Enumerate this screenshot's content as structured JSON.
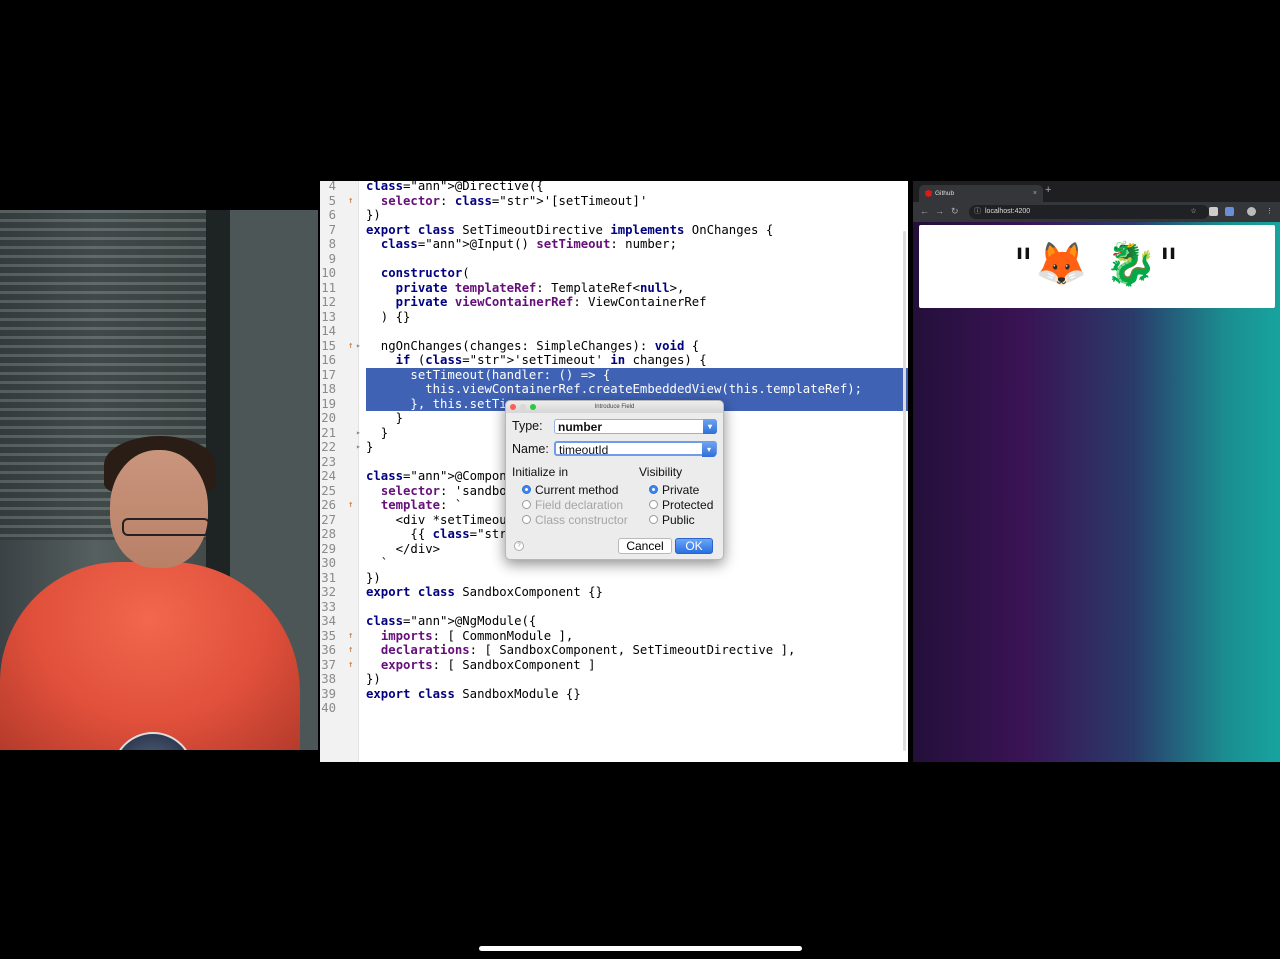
{
  "ide": {
    "lines": [
      {
        "n": "4",
        "t": "@Directive({",
        "mark": "",
        "fold": "",
        "cls": ""
      },
      {
        "n": "5",
        "t": "  selector: '[setTimeout]'",
        "mark": "↑",
        "fold": "",
        "cls": ""
      },
      {
        "n": "6",
        "t": "})",
        "mark": "",
        "fold": "",
        "cls": ""
      },
      {
        "n": "7",
        "t": "export class SetTimeoutDirective implements OnChanges {",
        "mark": "",
        "fold": "",
        "cls": ""
      },
      {
        "n": "8",
        "t": "  @Input() setTimeout: number;",
        "mark": "",
        "fold": "",
        "cls": ""
      },
      {
        "n": "9",
        "t": "",
        "mark": "",
        "fold": "",
        "cls": ""
      },
      {
        "n": "10",
        "t": "  constructor(",
        "mark": "",
        "fold": "",
        "cls": ""
      },
      {
        "n": "11",
        "t": "    private templateRef: TemplateRef<null>,",
        "mark": "",
        "fold": "",
        "cls": ""
      },
      {
        "n": "12",
        "t": "    private viewContainerRef: ViewContainerRef",
        "mark": "",
        "fold": "",
        "cls": ""
      },
      {
        "n": "13",
        "t": "  ) {}",
        "mark": "",
        "fold": "",
        "cls": ""
      },
      {
        "n": "14",
        "t": "",
        "mark": "",
        "fold": "",
        "cls": ""
      },
      {
        "n": "15",
        "t": "  ngOnChanges(changes: SimpleChanges): void {",
        "mark": "↑",
        "fold": "▸",
        "cls": ""
      },
      {
        "n": "16",
        "t": "    if ('setTimeout' in changes) {",
        "mark": "",
        "fold": "",
        "cls": ""
      },
      {
        "n": "17",
        "t": "      setTimeout(handler: () => {",
        "mark": "",
        "fold": "",
        "cls": "sel"
      },
      {
        "n": "18",
        "t": "        this.viewContainerRef.createEmbeddedView(this.templateRef);",
        "mark": "",
        "fold": "",
        "cls": "sel"
      },
      {
        "n": "19",
        "t": "      }, this.setTim",
        "mark": "",
        "fold": "",
        "cls": "sel"
      },
      {
        "n": "20",
        "t": "    }",
        "mark": "",
        "fold": "",
        "cls": ""
      },
      {
        "n": "21",
        "t": "  }",
        "mark": "",
        "fold": "▸",
        "cls": ""
      },
      {
        "n": "22",
        "t": "}",
        "mark": "",
        "fold": "▸",
        "cls": ""
      },
      {
        "n": "23",
        "t": "",
        "mark": "",
        "fold": "",
        "cls": ""
      },
      {
        "n": "24",
        "t": "@Component({",
        "mark": "",
        "fold": "",
        "cls": ""
      },
      {
        "n": "25",
        "t": "  selector: 'sandbox",
        "mark": "",
        "fold": "",
        "cls": ""
      },
      {
        "n": "26",
        "t": "  template: `",
        "mark": "↑",
        "fold": "",
        "cls": ""
      },
      {
        "n": "27",
        "t": "    <div *setTimeout",
        "mark": "",
        "fold": "",
        "cls": ""
      },
      {
        "n": "28",
        "t": "      {{ '🦊 🐉' | j",
        "mark": "",
        "fold": "",
        "cls": ""
      },
      {
        "n": "29",
        "t": "    </div>",
        "mark": "",
        "fold": "",
        "cls": ""
      },
      {
        "n": "30",
        "t": "  `",
        "mark": "",
        "fold": "",
        "cls": ""
      },
      {
        "n": "31",
        "t": "})",
        "mark": "",
        "fold": "",
        "cls": ""
      },
      {
        "n": "32",
        "t": "export class SandboxComponent {}",
        "mark": "",
        "fold": "",
        "cls": ""
      },
      {
        "n": "33",
        "t": "",
        "mark": "",
        "fold": "",
        "cls": ""
      },
      {
        "n": "34",
        "t": "@NgModule({",
        "mark": "",
        "fold": "",
        "cls": ""
      },
      {
        "n": "35",
        "t": "  imports: [ CommonModule ],",
        "mark": "↑",
        "fold": "",
        "cls": ""
      },
      {
        "n": "36",
        "t": "  declarations: [ SandboxComponent, SetTimeoutDirective ],",
        "mark": "↑",
        "fold": "",
        "cls": ""
      },
      {
        "n": "37",
        "t": "  exports: [ SandboxComponent ]",
        "mark": "↑",
        "fold": "",
        "cls": ""
      },
      {
        "n": "38",
        "t": "})",
        "mark": "",
        "fold": "",
        "cls": ""
      },
      {
        "n": "39",
        "t": "export class SandboxModule {}",
        "mark": "",
        "fold": "",
        "cls": ""
      },
      {
        "n": "40",
        "t": "",
        "mark": "",
        "fold": "",
        "cls": ""
      }
    ]
  },
  "dialog": {
    "title": "Introduce Field",
    "type_label": "Type:",
    "type_value": "number",
    "name_label": "Name:",
    "name_value": "timeoutId",
    "init_heading": "Initialize in",
    "visibility_heading": "Visibility",
    "init_options": [
      {
        "label": "Current method",
        "checked": true,
        "disabled": false
      },
      {
        "label": "Field declaration",
        "checked": false,
        "disabled": true
      },
      {
        "label": "Class constructor",
        "checked": false,
        "disabled": true
      }
    ],
    "visibility_options": [
      {
        "label": "Private",
        "checked": true
      },
      {
        "label": "Protected",
        "checked": false
      },
      {
        "label": "Public",
        "checked": false
      }
    ],
    "cancel_label": "Cancel",
    "ok_label": "OK",
    "help_label": "?"
  },
  "browser": {
    "tab_title": "Github",
    "tab_close": "×",
    "new_tab": "+",
    "url": "localhost:4200",
    "page_text": "\"🦊 🐉\""
  },
  "colors": {
    "selection": "#3f62b5",
    "keyword": "#000080",
    "string": "#067d17",
    "annotation": "#808000"
  }
}
